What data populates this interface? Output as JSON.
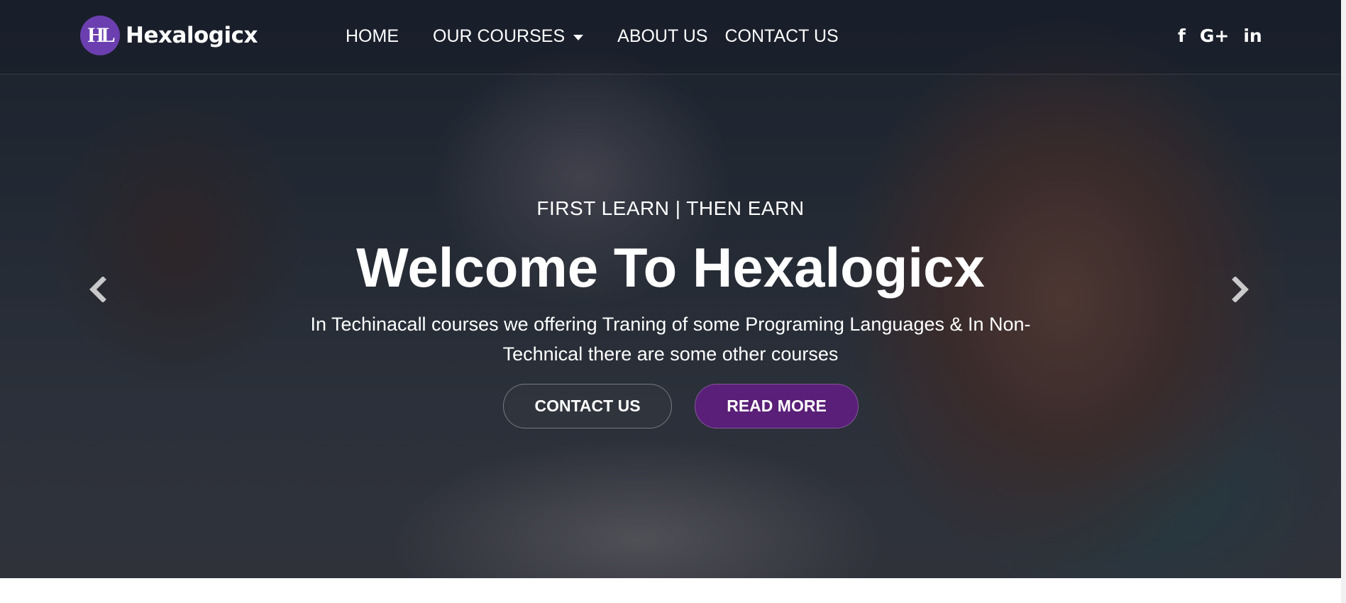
{
  "brand": {
    "logo_mark": "HL",
    "name": "Hexalogicx",
    "color": "#6b3fb0"
  },
  "nav": {
    "items": [
      {
        "label": "HOME"
      },
      {
        "label": "OUR COURSES"
      },
      {
        "label": "ABOUT US"
      },
      {
        "label": "CONTACT US"
      }
    ]
  },
  "social": {
    "facebook": "f",
    "google_plus": "G+",
    "linkedin": "in"
  },
  "hero": {
    "tagline": "FIRST LEARN | THEN EARN",
    "headline": "Welcome To Hexalogicx",
    "subtitle": "In Techinacall courses we offering Traning of some Programing Languages & In Non-Technical there are some other courses",
    "buttons": {
      "contact": "CONTACT US",
      "read_more": "READ MORE"
    },
    "accent_color": "#5a1f78"
  },
  "icons": {
    "prev": "chevron-left-icon",
    "next": "chevron-right-icon",
    "dropdown": "caret-down-icon"
  }
}
